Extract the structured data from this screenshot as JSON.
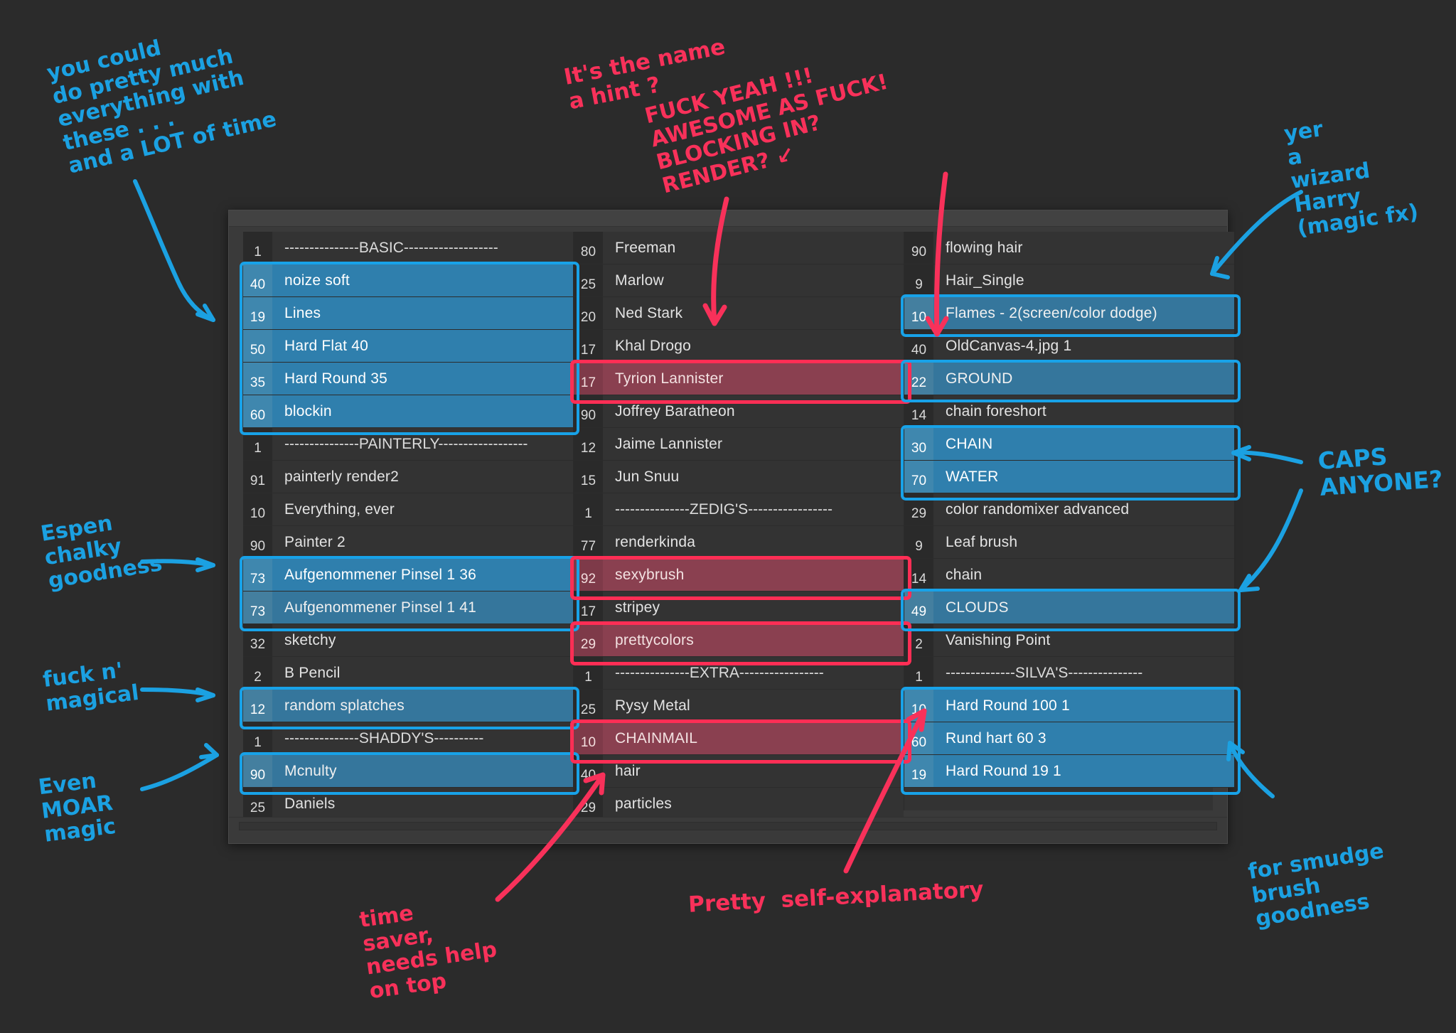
{
  "window": {
    "title": "",
    "type": "brush-palette"
  },
  "columns": [
    {
      "id": "column-1",
      "rows": [
        {
          "num": "1",
          "label": "---------------BASIC-------------------",
          "kind": "sep"
        },
        {
          "num": "40",
          "label": "noize soft",
          "kind": "sel"
        },
        {
          "num": "19",
          "label": "Lines",
          "kind": "sel"
        },
        {
          "num": "50",
          "label": "Hard Flat 40",
          "kind": "sel"
        },
        {
          "num": "35",
          "label": "Hard Round 35",
          "kind": "sel"
        },
        {
          "num": "60",
          "label": "blockin",
          "kind": "sel"
        },
        {
          "num": "1",
          "label": "---------------PAINTERLY------------------",
          "kind": "sep"
        },
        {
          "num": "91",
          "label": "painterly render2",
          "kind": "normal"
        },
        {
          "num": "10",
          "label": "Everything, ever",
          "kind": "normal"
        },
        {
          "num": "90",
          "label": "Painter 2",
          "kind": "normal"
        },
        {
          "num": "73",
          "label": "Aufgenommener Pinsel 1 36",
          "kind": "sel"
        },
        {
          "num": "73",
          "label": "Aufgenommener Pinsel 1 41",
          "kind": "sel2"
        },
        {
          "num": "32",
          "label": "sketchy",
          "kind": "normal"
        },
        {
          "num": "2",
          "label": "B Pencil",
          "kind": "normal"
        },
        {
          "num": "12",
          "label": "random splatches",
          "kind": "sel2"
        },
        {
          "num": "1",
          "label": "---------------SHADDY'S----------",
          "kind": "sep"
        },
        {
          "num": "90",
          "label": "Mcnulty",
          "kind": "sel2"
        },
        {
          "num": "25",
          "label": "Daniels",
          "kind": "normal"
        }
      ]
    },
    {
      "id": "column-2",
      "rows": [
        {
          "num": "80",
          "label": "Freeman",
          "kind": "normal"
        },
        {
          "num": "25",
          "label": "Marlow",
          "kind": "normal"
        },
        {
          "num": "20",
          "label": "Ned Stark",
          "kind": "normal"
        },
        {
          "num": "17",
          "label": "Khal Drogo",
          "kind": "normal"
        },
        {
          "num": "17",
          "label": "Tyrion Lannister",
          "kind": "red"
        },
        {
          "num": "90",
          "label": "Joffrey Baratheon",
          "kind": "normal"
        },
        {
          "num": "12",
          "label": "Jaime Lannister",
          "kind": "normal"
        },
        {
          "num": "15",
          "label": "Jun Snuu",
          "kind": "normal"
        },
        {
          "num": "1",
          "label": "---------------ZEDIG'S-----------------",
          "kind": "sep"
        },
        {
          "num": "77",
          "label": "renderkinda",
          "kind": "normal"
        },
        {
          "num": "92",
          "label": "sexybrush",
          "kind": "red"
        },
        {
          "num": "17",
          "label": "stripey",
          "kind": "normal"
        },
        {
          "num": "29",
          "label": "prettycolors",
          "kind": "red"
        },
        {
          "num": "1",
          "label": "---------------EXTRA-----------------",
          "kind": "sep"
        },
        {
          "num": "25",
          "label": "Rysy Metal",
          "kind": "normal"
        },
        {
          "num": "10",
          "label": "CHAINMAIL",
          "kind": "red"
        },
        {
          "num": "40",
          "label": "hair",
          "kind": "normal"
        },
        {
          "num": "29",
          "label": "particles",
          "kind": "normal"
        }
      ]
    },
    {
      "id": "column-3",
      "rows": [
        {
          "num": "90",
          "label": "flowing hair",
          "kind": "normal"
        },
        {
          "num": "9",
          "label": "Hair_Single",
          "kind": "normal"
        },
        {
          "num": "10",
          "label": "Flames - 2(screen/color dodge)",
          "kind": "sel2"
        },
        {
          "num": "40",
          "label": "OldCanvas-4.jpg 1",
          "kind": "normal"
        },
        {
          "num": "22",
          "label": "GROUND",
          "kind": "sel2"
        },
        {
          "num": "14",
          "label": "chain foreshort",
          "kind": "normal"
        },
        {
          "num": "30",
          "label": "CHAIN",
          "kind": "sel"
        },
        {
          "num": "70",
          "label": "WATER",
          "kind": "sel"
        },
        {
          "num": "29",
          "label": "color randomixer advanced",
          "kind": "normal"
        },
        {
          "num": "9",
          "label": "Leaf brush",
          "kind": "normal"
        },
        {
          "num": "14",
          "label": "chain",
          "kind": "normal"
        },
        {
          "num": "49",
          "label": "CLOUDS",
          "kind": "sel2"
        },
        {
          "num": "2",
          "label": "Vanishing Point",
          "kind": "normal"
        },
        {
          "num": "1",
          "label": "--------------SILVA'S---------------",
          "kind": "sep"
        },
        {
          "num": "10",
          "label": "Hard Round 100 1",
          "kind": "sel"
        },
        {
          "num": "60",
          "label": "Rund hart 60 3",
          "kind": "sel"
        },
        {
          "num": "19",
          "label": "Hard Round 19 1",
          "kind": "sel"
        }
      ]
    }
  ],
  "annotations": {
    "blue": [
      {
        "id": "note-basic-brushes",
        "text": "you could\ndo pretty much\neverything with\nthese . . .\nand a LOT of time"
      },
      {
        "id": "note-magic-fx",
        "text": "yer\na\nwizard\nHarry\n(magic fx)"
      },
      {
        "id": "note-caps",
        "text": "CAPS\nANYONE?"
      },
      {
        "id": "note-espen-chalky",
        "text": "Espen\nchalky\ngoodness"
      },
      {
        "id": "note-fuckn-magical",
        "text": "fuck n'\nmagical"
      },
      {
        "id": "note-even-moar-magic",
        "text": "Even\nMOAR\nmagic"
      },
      {
        "id": "note-smudge-goodness",
        "text": "for smudge\nbrush\ngoodness"
      }
    ],
    "red": [
      {
        "id": "note-name-hint",
        "text": "It's the name\na hint ?"
      },
      {
        "id": "note-fuck-yeah",
        "text": "FUCK YEAH !!!\nAWESOME AS FUCK!\nBLOCKING IN?\nRENDER? ↙"
      },
      {
        "id": "note-time-saver",
        "text": "time\nsaver,\nneeds help\non top"
      },
      {
        "id": "note-self-explanatory",
        "text": "Pretty  self-explanatory"
      }
    ]
  },
  "colors": {
    "background": "#2b2b2b",
    "panel": "#3a3a3a",
    "list_row": "#333333",
    "selected_blue": "#2f7fad",
    "highlight_red": "#8a4050",
    "ink_blue": "#1ba1e2",
    "ink_red": "#f8315a"
  }
}
